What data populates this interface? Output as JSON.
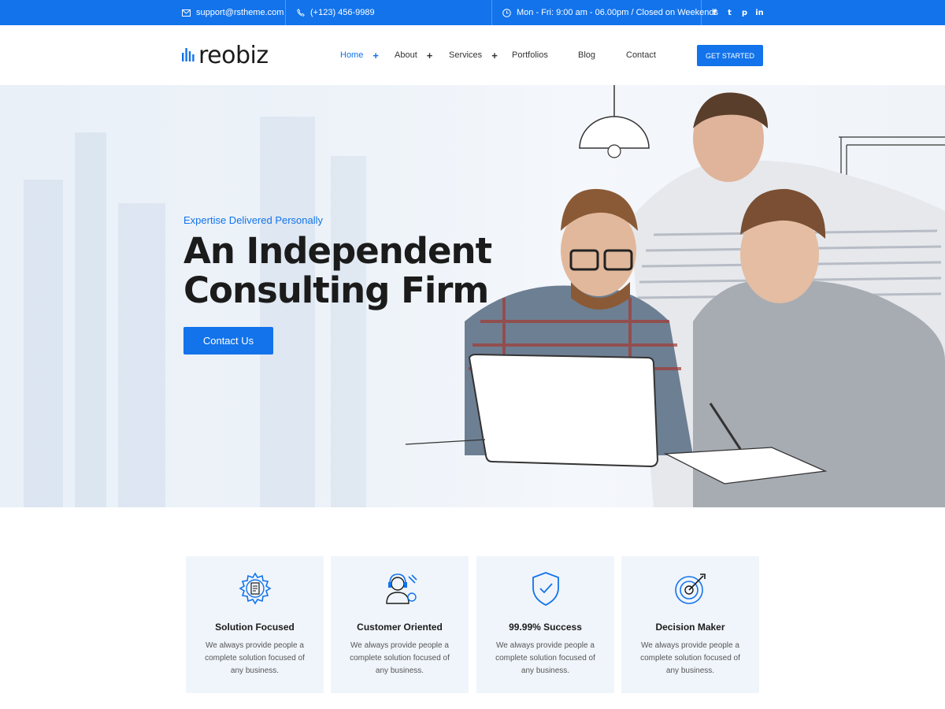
{
  "topbar": {
    "email": "support@rstheme.com",
    "phone": "(+123) 456-9989",
    "hours": "Mon - Fri: 9:00 am - 06.00pm / Closed on Weekends",
    "social": [
      {
        "icon": "facebook-icon",
        "glyph": "f"
      },
      {
        "icon": "twitter-icon",
        "glyph": "t"
      },
      {
        "icon": "pinterest-icon",
        "glyph": "p"
      },
      {
        "icon": "linkedin-icon",
        "glyph": "in"
      }
    ]
  },
  "header": {
    "logo_text": "reobiz",
    "nav": [
      {
        "label": "Home",
        "plus": "+",
        "active": true
      },
      {
        "label": "About",
        "plus": "+"
      },
      {
        "label": "Services",
        "plus": "+"
      },
      {
        "label": "Portfolios",
        "plus": ""
      },
      {
        "label": "Blog",
        "plus": ""
      },
      {
        "label": "Contact",
        "plus": ""
      }
    ],
    "cta_label": "GET STARTED"
  },
  "hero": {
    "tagline": "Expertise Delivered Personally",
    "title": "An Independent Consulting Firm",
    "button_label": "Contact Us"
  },
  "features": [
    {
      "icon": "gear-document-icon",
      "title": "Solution Focused",
      "desc": "We always provide people a complete solution focused of any business."
    },
    {
      "icon": "support-agent-icon",
      "title": "Customer Oriented",
      "desc": "We always provide people a complete solution focused of any business."
    },
    {
      "icon": "shield-check-icon",
      "title": "99.99% Success",
      "desc": "We always provide people a complete solution focused of any business."
    },
    {
      "icon": "target-icon",
      "title": "Decision Maker",
      "desc": "We always provide people a complete solution focused of any business."
    }
  ],
  "colors": {
    "accent": "#1273eb",
    "text": "#1b1b1b",
    "card_bg": "#f0f5fb"
  }
}
